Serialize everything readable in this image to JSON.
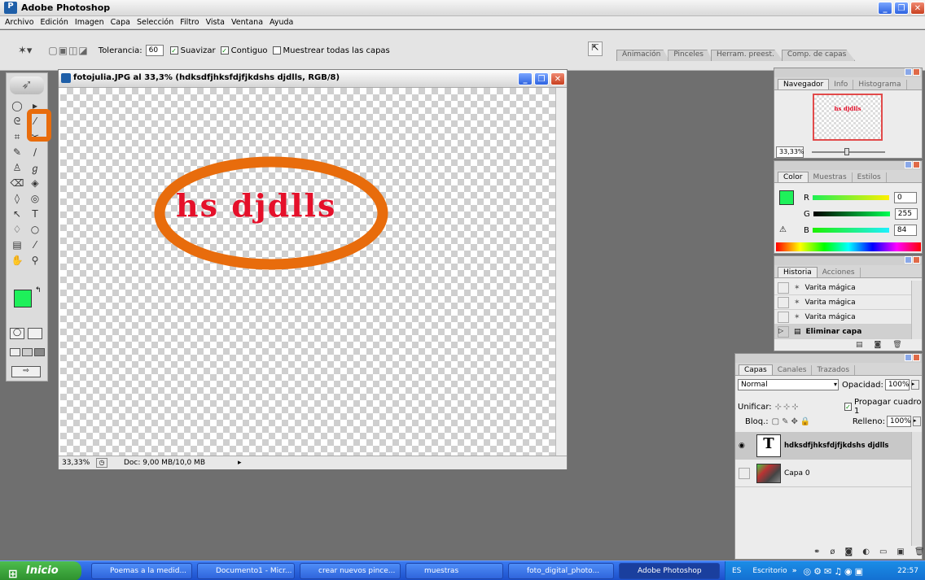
{
  "app": {
    "title": "Adobe Photoshop"
  },
  "menu": [
    "Archivo",
    "Edición",
    "Imagen",
    "Capa",
    "Selección",
    "Filtro",
    "Vista",
    "Ventana",
    "Ayuda"
  ],
  "options": {
    "tolerance_label": "Tolerancia:",
    "tolerance_value": "60",
    "smooth": "Suavizar",
    "contiguous": "Contiguo",
    "sample_all": "Muestrear todas las capas"
  },
  "well_tabs": [
    "Animación",
    "Pinceles",
    "Herram. preest.",
    "Comp. de capas"
  ],
  "document": {
    "title": "fotojulia.JPG al 33,3% (hdksdfjhksfdjfjkdshs djdlls, RGB/8)",
    "text": "hs djdlls",
    "zoom": "33,33%",
    "doc_size": "Doc: 9,00 MB/10,0 MB"
  },
  "navigator": {
    "tabs": [
      "Navegador",
      "Info",
      "Histograma"
    ],
    "zoom": "33,33%",
    "thumb_text": "hs djdlls"
  },
  "color": {
    "tabs": [
      "Color",
      "Muestras",
      "Estilos"
    ],
    "r_label": "R",
    "g_label": "G",
    "b_label": "B",
    "r": "0",
    "g": "255",
    "b": "84",
    "fg": "#1ef05a",
    "bg": "#4a1e08"
  },
  "history": {
    "tabs": [
      "Historia",
      "Acciones"
    ],
    "items": [
      "Varita mágica",
      "Varita mágica",
      "Varita mágica",
      "Eliminar capa"
    ]
  },
  "layers": {
    "tabs": [
      "Capas",
      "Canales",
      "Trazados"
    ],
    "blend": "Normal",
    "opacity_label": "Opacidad:",
    "opacity": "100%",
    "unify_label": "Unificar:",
    "propagate": "Propagar cuadro 1",
    "lock_label": "Bloq.:",
    "fill_label": "Relleno:",
    "fill": "100%",
    "items": [
      {
        "name": "hdksdfjhksfdjfjkdshs djdlls",
        "thumb": "T"
      },
      {
        "name": "Capa 0"
      }
    ]
  },
  "taskbar": {
    "start": "Inicio",
    "tasks": [
      "Poemas a la medid...",
      "Documento1 - Micr...",
      "crear nuevos pince...",
      "muestras",
      "foto_digital_photo...",
      "Adobe Photoshop"
    ],
    "lang": "ES",
    "desktop": "Escritorio",
    "clock": "22:57"
  },
  "colors": {
    "highlight": "#e86c0c",
    "text_red": "#e5102a"
  }
}
